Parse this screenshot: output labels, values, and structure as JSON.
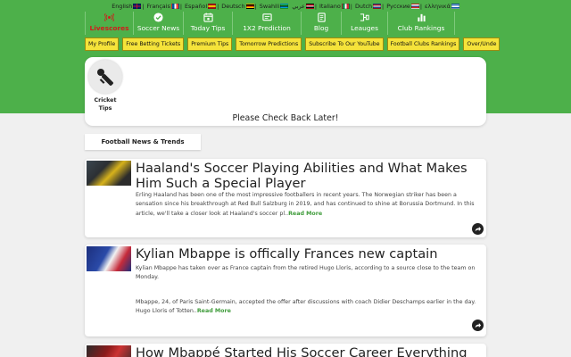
{
  "languages": [
    {
      "label": "English",
      "flag": "flag-en"
    },
    {
      "label": "Français",
      "flag": "flag-fr"
    },
    {
      "label": "Español",
      "flag": "flag-es"
    },
    {
      "label": "Deutsch",
      "flag": "flag-de"
    },
    {
      "label": "Swahili",
      "flag": "flag-sw"
    },
    {
      "label": "عربي",
      "flag": "flag-ar"
    },
    {
      "label": "Italiano",
      "flag": "flag-it"
    },
    {
      "label": "Dutch",
      "flag": "flag-nl"
    },
    {
      "label": "Русские",
      "flag": "flag-ru"
    },
    {
      "label": "ελληνικά",
      "flag": "flag-gr"
    }
  ],
  "nav": [
    {
      "label": "Livescores",
      "icon": "live-signal-icon",
      "active": true
    },
    {
      "label": "Soccer News",
      "icon": "check-badge-icon"
    },
    {
      "label": "Today Tips",
      "icon": "calendar-icon"
    },
    {
      "label": "1X2 Prediction",
      "icon": "screen-icon"
    },
    {
      "label": "Blog",
      "icon": "document-icon"
    },
    {
      "label": "Leauges",
      "icon": "bracket-icon"
    },
    {
      "label": "Club Rankings",
      "icon": "bar-chart-icon"
    }
  ],
  "subnav": [
    "My Profile",
    "Free Betting Tickets",
    "Premium Tips",
    "Tomorrow Predictions",
    "Subscribe To Our YouTube",
    "Football Clubs Rankings",
    "Over/Unde"
  ],
  "panel": {
    "category_label_1": "Cricket",
    "category_label_2": "Tips",
    "empty_message": "Please Check Back Later!"
  },
  "section_title": "Football News & Trends",
  "articles": [
    {
      "title": "Haaland's Soccer Playing Abilities and What Makes Him Such a Special Player",
      "body": "Erling Haaland has been one of the most impressive footballers in recent years. The Norwegian striker has been a sensation since his breakthrough at Red Bull Salzburg in 2019, and has continued to shine at Borussia Dortmund. In this article, we'll take a closer look at Haaland's soccer pl..",
      "read_more": "Read More"
    },
    {
      "title": "Kylian Mbappe is offically Frances new captain",
      "body_p1": "Kylian Mbappe has taken over as France captain from the retired Hugo Lloris, according to a source close to the team on Monday.",
      "body_p2": "Mbappe, 24, of Paris Saint-Germain, accepted the offer after discussions with coach Didier Deschamps earlier in the day. Hugo Lloris of Totten..",
      "read_more": "Read More"
    },
    {
      "title": "How Mbappé Started His Soccer Career Everything"
    }
  ]
}
